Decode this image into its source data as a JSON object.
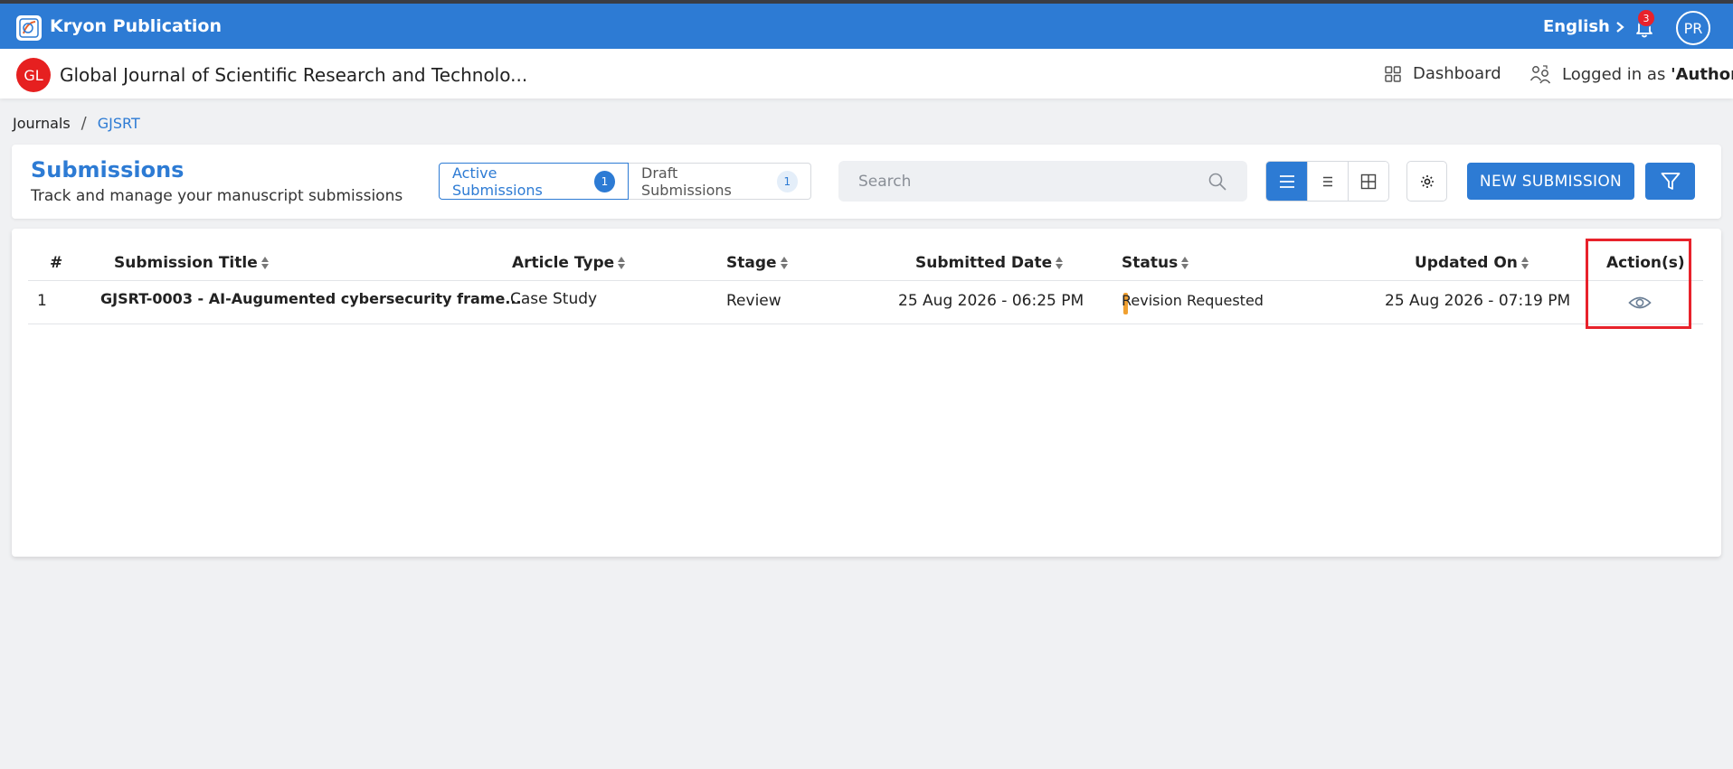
{
  "app": {
    "title": "Kryon Publication",
    "language": "English",
    "notification_count": "3",
    "avatar_initials": "PR"
  },
  "journal": {
    "logo_initials": "GL",
    "title": "Global Journal of Scientific Research and Technolo...",
    "dashboard_label": "Dashboard",
    "logged_in_prefix": "Logged in as ",
    "logged_in_role": "'Author'"
  },
  "breadcrumb": {
    "journals": "Journals",
    "separator": "/",
    "current": "GJSRT"
  },
  "submissions_header": {
    "title": "Submissions",
    "subtitle": "Track and manage your manuscript submissions",
    "tabs": [
      {
        "label": "Active Submissions",
        "count": "1"
      },
      {
        "label": "Draft Submissions",
        "count": "1"
      }
    ],
    "search_placeholder": "Search",
    "new_submission_label": "NEW SUBMISSION"
  },
  "table": {
    "columns": [
      "#",
      "Submission Title",
      "Article Type",
      "Stage",
      "Submitted Date",
      "Status",
      "Updated On",
      "Action(s)"
    ],
    "rows": [
      {
        "num": "1",
        "title": "GJSRT-0003 - AI-Augumented cybersecurity frame...",
        "article_type": "Case Study",
        "stage": "Review",
        "submitted": "25 Aug 2026 - 06:25 PM",
        "status": "Revision Requested",
        "updated": "25 Aug 2026 - 07:19 PM"
      }
    ]
  },
  "colors": {
    "primary": "#2d7bd4",
    "status_revision": "#f0a030",
    "highlight": "#e8222b",
    "badge": "#e8222b"
  }
}
